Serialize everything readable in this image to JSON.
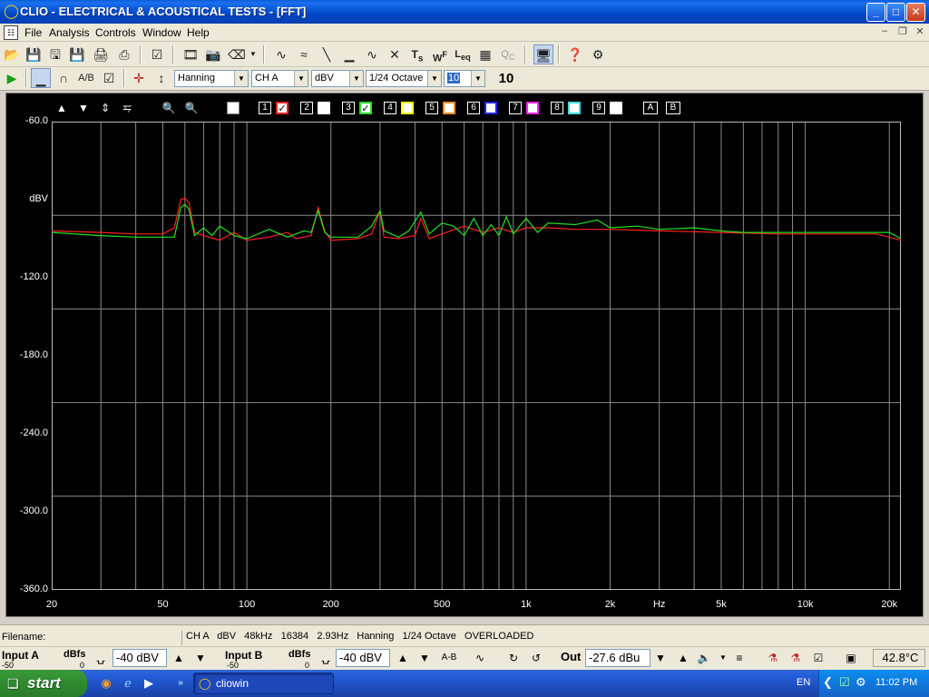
{
  "window": {
    "title": "CLIO - ELECTRICAL & ACOUSTICAL TESTS - [FFT]"
  },
  "menu": [
    "File",
    "Analysis",
    "Controls",
    "Window",
    "Help"
  ],
  "toolbar2": {
    "window_fn": "Hanning",
    "channel": "CH A",
    "unit": "dBV",
    "smoothing": "1/24 Octave",
    "averages_selected": "10",
    "averages_display": "10"
  },
  "plot_controls": {
    "curve_numbers": [
      "1",
      "2",
      "3",
      "4",
      "5",
      "6",
      "7",
      "8",
      "9"
    ],
    "curve_colors": [
      "#ff2020",
      "#ffffff",
      "#20e020",
      "#ffff00",
      "#ff8c1a",
      "#2020ff",
      "#ff20ff",
      "#40e0e0",
      "#ffffff"
    ],
    "checked_curves": [
      1,
      3
    ],
    "ab": [
      "A",
      "B"
    ]
  },
  "chart_data": {
    "type": "line",
    "title": "",
    "xlabel": "Hz",
    "ylabel": "dBV",
    "x_scale": "log",
    "xlim": [
      20,
      22000
    ],
    "ylim": [
      -360,
      -60
    ],
    "y_ticks": [
      "-60.0",
      "dBV",
      "-120.0",
      "-180.0",
      "-240.0",
      "-300.0",
      "-360.0"
    ],
    "x_ticks": [
      "20",
      "50",
      "100",
      "200",
      "500",
      "1k",
      "2k",
      "Hz",
      "5k",
      "10k",
      "20k"
    ],
    "grid": true,
    "series": [
      {
        "color": "#ff2020",
        "points": [
          [
            20,
            -130
          ],
          [
            30,
            -131
          ],
          [
            40,
            -132
          ],
          [
            50,
            -132
          ],
          [
            55,
            -128
          ],
          [
            58,
            -110
          ],
          [
            60,
            -109
          ],
          [
            62,
            -112
          ],
          [
            65,
            -131
          ],
          [
            70,
            -133
          ],
          [
            80,
            -136
          ],
          [
            90,
            -131
          ],
          [
            100,
            -136
          ],
          [
            120,
            -134
          ],
          [
            140,
            -131
          ],
          [
            150,
            -135
          ],
          [
            170,
            -133
          ],
          [
            180,
            -115
          ],
          [
            190,
            -130
          ],
          [
            200,
            -136
          ],
          [
            250,
            -135
          ],
          [
            280,
            -132
          ],
          [
            300,
            -117
          ],
          [
            310,
            -134
          ],
          [
            350,
            -135
          ],
          [
            400,
            -133
          ],
          [
            420,
            -122
          ],
          [
            450,
            -135
          ],
          [
            500,
            -132
          ],
          [
            600,
            -127
          ],
          [
            700,
            -131
          ],
          [
            800,
            -128
          ],
          [
            900,
            -131
          ],
          [
            1000,
            -128
          ],
          [
            1200,
            -128
          ],
          [
            1500,
            -129
          ],
          [
            2000,
            -129
          ],
          [
            3000,
            -130
          ],
          [
            5000,
            -131
          ],
          [
            8000,
            -132
          ],
          [
            12000,
            -132
          ],
          [
            18000,
            -132
          ],
          [
            22000,
            -136
          ]
        ]
      },
      {
        "color": "#20e020",
        "points": [
          [
            20,
            -131
          ],
          [
            30,
            -133
          ],
          [
            40,
            -134
          ],
          [
            45,
            -134
          ],
          [
            50,
            -134
          ],
          [
            55,
            -134
          ],
          [
            58,
            -115
          ],
          [
            60,
            -113
          ],
          [
            62,
            -116
          ],
          [
            65,
            -133
          ],
          [
            70,
            -128
          ],
          [
            75,
            -133
          ],
          [
            80,
            -127
          ],
          [
            90,
            -133
          ],
          [
            100,
            -135
          ],
          [
            120,
            -129
          ],
          [
            140,
            -134
          ],
          [
            160,
            -130
          ],
          [
            170,
            -131
          ],
          [
            180,
            -117
          ],
          [
            190,
            -131
          ],
          [
            200,
            -134
          ],
          [
            250,
            -134
          ],
          [
            280,
            -127
          ],
          [
            300,
            -117
          ],
          [
            310,
            -130
          ],
          [
            350,
            -134
          ],
          [
            380,
            -130
          ],
          [
            420,
            -118
          ],
          [
            450,
            -132
          ],
          [
            500,
            -125
          ],
          [
            550,
            -127
          ],
          [
            600,
            -133
          ],
          [
            650,
            -122
          ],
          [
            700,
            -133
          ],
          [
            750,
            -126
          ],
          [
            800,
            -133
          ],
          [
            850,
            -121
          ],
          [
            900,
            -132
          ],
          [
            1000,
            -122
          ],
          [
            1100,
            -131
          ],
          [
            1200,
            -125
          ],
          [
            1500,
            -126
          ],
          [
            1800,
            -123
          ],
          [
            2000,
            -128
          ],
          [
            2500,
            -127
          ],
          [
            3000,
            -129
          ],
          [
            4000,
            -128
          ],
          [
            5000,
            -130
          ],
          [
            6000,
            -131
          ],
          [
            8000,
            -131
          ],
          [
            10000,
            -131
          ],
          [
            15000,
            -131
          ],
          [
            20000,
            -131
          ],
          [
            22000,
            -135
          ]
        ]
      }
    ]
  },
  "status": {
    "filename_label": "Filename:",
    "channel": "CH A",
    "unit": "dBV",
    "sample_rate": "48kHz",
    "fft_size": "16384",
    "resolution": "2.93Hz",
    "window_fn": "Hanning",
    "smoothing": "1/24 Octave",
    "overload": "OVERLOADED"
  },
  "inputs": {
    "input_a": "Input A",
    "input_a_unit": "dBfs",
    "input_a_scale_min": "-50",
    "input_a_scale_max": "0",
    "input_a_value": "-40 dBV",
    "input_b": "Input B",
    "input_b_unit": "dBfs",
    "input_b_scale_min": "-50",
    "input_b_scale_max": "0",
    "input_b_value": "-40 dBV",
    "ab_label": "A-B",
    "out_label": "Out",
    "out_value": "-27.6 dBu",
    "temperature": "42.8°C"
  },
  "taskbar": {
    "start": "start",
    "task": "cliowin",
    "lang": "EN",
    "clock": "11:02 PM"
  }
}
